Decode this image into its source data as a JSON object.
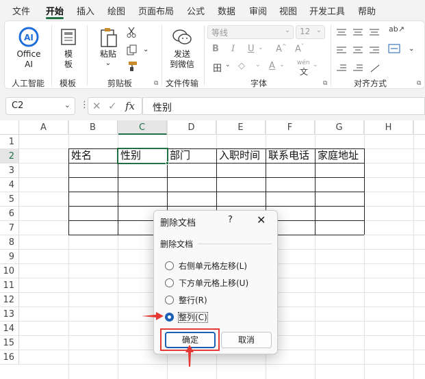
{
  "menu_tabs": [
    "文件",
    "开始",
    "插入",
    "绘图",
    "页面布局",
    "公式",
    "数据",
    "审阅",
    "视图",
    "开发工具",
    "帮助"
  ],
  "active_tab": "开始",
  "ribbon": {
    "office_ai": {
      "label_line1": "Office",
      "label_line2": "AI",
      "group": "人工智能"
    },
    "template": {
      "label_line1": "模",
      "label_line2": "板",
      "group": "模板"
    },
    "clipboard": {
      "paste": "粘贴",
      "group": "剪贴板"
    },
    "file_transfer": {
      "label_line1": "发送",
      "label_line2": "到微信",
      "group": "文件传输"
    },
    "font": {
      "name": "等线",
      "size": "12",
      "bold": "B",
      "italic": "I",
      "underline": "U",
      "group": "字体",
      "phonetic": "wén"
    },
    "alignment": {
      "group": "对齐方式"
    }
  },
  "formula_bar": {
    "name_box": "C2",
    "formula": "性别",
    "fx": "fx"
  },
  "columns": [
    "A",
    "B",
    "C",
    "D",
    "E",
    "F",
    "G",
    "H"
  ],
  "selected_column": "C",
  "rows": [
    "1",
    "2",
    "3",
    "4",
    "5",
    "6",
    "7",
    "8",
    "9",
    "10",
    "11",
    "12",
    "13",
    "14",
    "15",
    "16"
  ],
  "selected_row": "2",
  "table_headers": [
    "姓名",
    "性别",
    "部门",
    "入职时间",
    "联系电话",
    "家庭地址"
  ],
  "dialog": {
    "title": "删除文档",
    "help": "?",
    "close": "✕",
    "group_label": "删除文档",
    "options": [
      "右侧单元格左移(L)",
      "下方单元格上移(U)",
      "整行(R)",
      "整列(C)"
    ],
    "selected_option": "整列(C)",
    "ok": "确定",
    "cancel": "取消"
  },
  "colors": {
    "accent": "#1e7145",
    "highlight": "#e53935",
    "radio_selected": "#1a5fb4"
  }
}
